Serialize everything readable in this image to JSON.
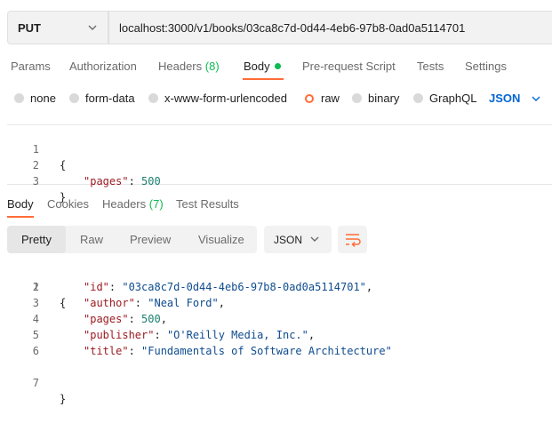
{
  "request": {
    "method": "PUT",
    "url": "localhost:3000/v1/books/03ca8c7d-0d44-4eb6-97b8-0ad0a5114701"
  },
  "request_tabs": {
    "params": "Params",
    "authorization": "Authorization",
    "headers_label": "Headers",
    "headers_count": "(8)",
    "body": "Body",
    "prerequest": "Pre-request Script",
    "tests": "Tests",
    "settings": "Settings"
  },
  "body_types": {
    "none": "none",
    "form_data": "form-data",
    "urlencoded": "x-www-form-urlencoded",
    "raw": "raw",
    "binary": "binary",
    "graphql": "GraphQL",
    "format": "JSON",
    "selected": "raw"
  },
  "request_body": {
    "line_numbers": [
      "1",
      "2",
      "3"
    ],
    "open": "{",
    "key": "\"pages\"",
    "sep": ": ",
    "value": "500",
    "close": "}"
  },
  "response_tabs": {
    "body": "Body",
    "cookies": "Cookies",
    "headers_label": "Headers",
    "headers_count": "(7)",
    "test_results": "Test Results"
  },
  "response_view": {
    "pretty": "Pretty",
    "raw": "Raw",
    "preview": "Preview",
    "visualize": "Visualize",
    "format": "JSON"
  },
  "response_body": {
    "line_numbers": [
      "1",
      "2",
      "3",
      "4",
      "5",
      "6",
      "7"
    ],
    "open": "{",
    "close": "}",
    "fields": [
      {
        "key": "\"id\"",
        "value": "\"03ca8c7d-0d44-4eb6-97b8-0ad0a5114701\"",
        "type": "str",
        "comma": ","
      },
      {
        "key": "\"author\"",
        "value": "\"Neal Ford\"",
        "type": "str",
        "comma": ","
      },
      {
        "key": "\"pages\"",
        "value": "500",
        "type": "num",
        "comma": ","
      },
      {
        "key": "\"publisher\"",
        "value": "\"O'Reilly Media, Inc.\"",
        "type": "str",
        "comma": ","
      },
      {
        "key": "\"title\"",
        "value": "\"Fundamentals of Software Architecture\"",
        "type": "str",
        "comma": ""
      }
    ]
  },
  "colors": {
    "accent": "#ff6c37",
    "active_green": "#0cbb52",
    "link_blue": "#0265d2"
  }
}
